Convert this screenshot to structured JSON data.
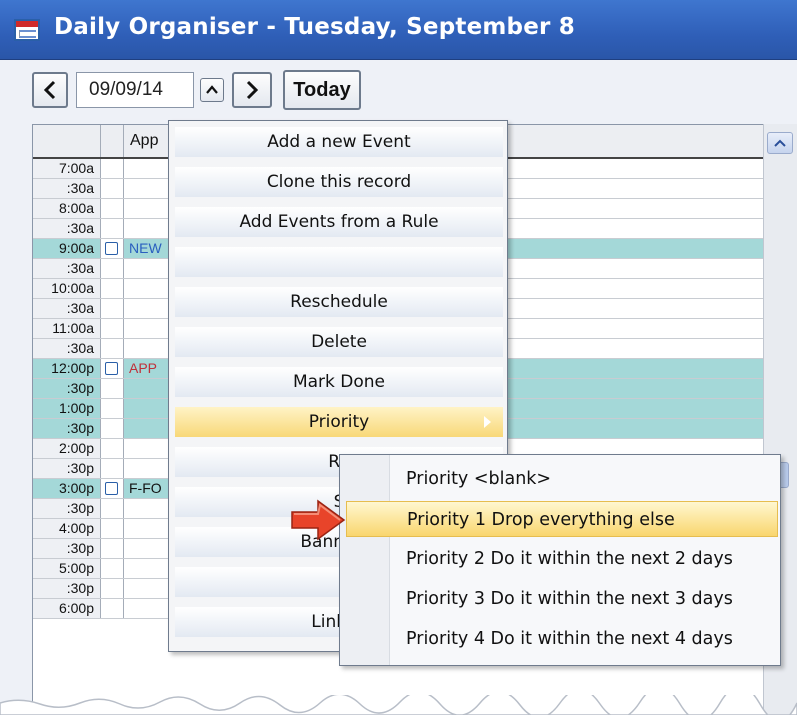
{
  "window": {
    "title": "Daily Organiser - Tuesday, September 8"
  },
  "toolbar": {
    "date_value": "09/09/14",
    "today_label": "Today"
  },
  "grid": {
    "header_label": "App",
    "times": [
      "7:00a",
      ":30a",
      "8:00a",
      ":30a",
      "9:00a",
      ":30a",
      "10:00a",
      ":30a",
      "11:00a",
      ":30a",
      "12:00p",
      ":30p",
      "1:00p",
      ":30p",
      "2:00p",
      ":30p",
      "3:00p",
      ":30p",
      "4:00p",
      ":30p",
      "5:00p",
      ":30p",
      "6:00p"
    ],
    "events": [
      {
        "time": "9:00a",
        "text": "NEW",
        "color": "#2a5fbf"
      },
      {
        "time": "12:00p",
        "text": "APP",
        "color": "#c0303a"
      },
      {
        "time": "3:00p",
        "text": "F-FO",
        "color": "#111111"
      }
    ],
    "highlight_color": "#a4d8d8"
  },
  "menu": {
    "items": [
      {
        "label": "Add a new Event",
        "mnemonic": "A"
      },
      {
        "label": "Clone this record",
        "mnemonic": "C"
      },
      {
        "label": "Add Events from a Rule",
        "mnemonic": "R"
      },
      {
        "label": "",
        "mnemonic": ""
      },
      {
        "label": "Reschedule",
        "mnemonic": "c"
      },
      {
        "label": "Delete",
        "mnemonic": "D"
      },
      {
        "label": "Mark Done",
        "mnemonic": "k"
      },
      {
        "label": "Priority",
        "mnemonic": "P",
        "active": true,
        "has_submenu": true
      },
      {
        "label": "Re",
        "mnemonic": ""
      },
      {
        "label": "S",
        "mnemonic": ""
      },
      {
        "label": "Banner d",
        "mnemonic": "B"
      },
      {
        "label": "",
        "mnemonic": ""
      },
      {
        "label": "Linked",
        "mnemonic": "L"
      }
    ]
  },
  "submenu": {
    "items": [
      {
        "label": "Priority <blank>",
        "mnemonic": "b"
      },
      {
        "label": "Priority 1 Drop everything else",
        "mnemonic": "1",
        "active": true
      },
      {
        "label": "Priority 2 Do it within the next 2 days",
        "mnemonic": "2"
      },
      {
        "label": "Priority 3 Do it within the next 3 days",
        "mnemonic": "3"
      },
      {
        "label": "Priority 4 Do it within the next 4 days",
        "mnemonic": "4"
      }
    ]
  },
  "colors": {
    "titlebar": "#2f5fb8",
    "menu_active": "#f8d878",
    "pointer": "#e8442a"
  }
}
